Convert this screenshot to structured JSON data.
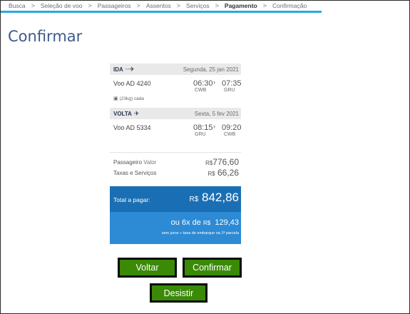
{
  "breadcrumb": {
    "steps": [
      "Busca",
      "Seleção de voo",
      "Passageiros",
      "Assentos",
      "Serviços",
      "Pagamento",
      "Confirmação"
    ],
    "separator": ">"
  },
  "page_title": "Confirmar",
  "summary": {
    "outbound": {
      "label": "IDA",
      "date": "Segunda, 25  jan 2021",
      "flight": "Voo  AD 4240",
      "depart_time": "06:30",
      "arrive_time": "07:35",
      "origin": "CWB",
      "destination": "GRU",
      "baggage": "(23kg) cada"
    },
    "return": {
      "label": "VOLTA",
      "date": "Sexta, 5  fev 2021",
      "flight": "Voo  AD 5334",
      "depart_time": "08:15",
      "arrive_time": "09:20",
      "origin": "GRU",
      "destination": "CWB"
    },
    "passenger_label": "Passageiro",
    "passenger_sub": "Valor",
    "passenger_currency": "R$",
    "passenger_value": "776,60",
    "taxes_label": "Taxas e Serviços",
    "taxes_currency": "R$",
    "taxes_value": "66,26",
    "total_label": "Total a pagar:",
    "total_currency": "R$",
    "total_value": "842,86",
    "installments_prefix": "ou",
    "installments_count": "6x",
    "installments_de": "de",
    "installments_currency": "R$",
    "installments_value": "129,43",
    "installments_note": "sem juros + taxa de embarque na 1ª parcela"
  },
  "buttons": {
    "back": "Voltar",
    "confirm": "Confirmar",
    "cancel": "Desistir"
  },
  "colors": {
    "breadcrumb_underline": "#27a9e1",
    "title": "#3e5a8a",
    "total_bg": "#1a6fb4",
    "installments_bg": "#2d8ad4",
    "button_bg": "#3a8a08"
  }
}
